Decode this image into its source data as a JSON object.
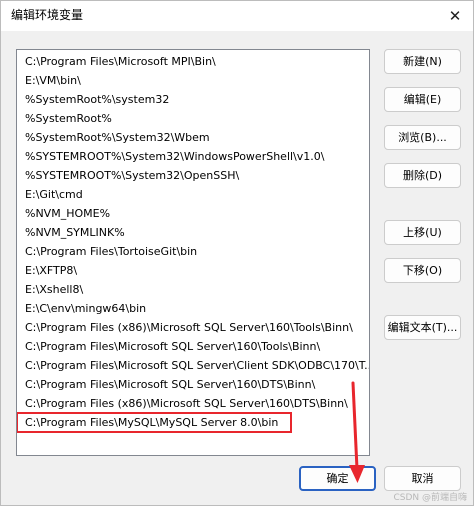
{
  "window": {
    "title": "编辑环境变量",
    "close_glyph": "✕"
  },
  "path_list": {
    "items": [
      {
        "text": "C:\\Program Files\\Microsoft MPI\\Bin\\"
      },
      {
        "text": "E:\\VM\\bin\\"
      },
      {
        "text": "%SystemRoot%\\system32"
      },
      {
        "text": "%SystemRoot%"
      },
      {
        "text": "%SystemRoot%\\System32\\Wbem"
      },
      {
        "text": "%SYSTEMROOT%\\System32\\WindowsPowerShell\\v1.0\\"
      },
      {
        "text": "%SYSTEMROOT%\\System32\\OpenSSH\\"
      },
      {
        "text": "E:\\Git\\cmd"
      },
      {
        "text": "%NVM_HOME%"
      },
      {
        "text": "%NVM_SYMLINK%"
      },
      {
        "text": "C:\\Program Files\\TortoiseGit\\bin"
      },
      {
        "text": "E:\\XFTP8\\"
      },
      {
        "text": "E:\\Xshell8\\"
      },
      {
        "text": "E:\\C\\env\\mingw64\\bin"
      },
      {
        "text": "C:\\Program Files (x86)\\Microsoft SQL Server\\160\\Tools\\Binn\\"
      },
      {
        "text": "C:\\Program Files\\Microsoft SQL Server\\160\\Tools\\Binn\\"
      },
      {
        "text": "C:\\Program Files\\Microsoft SQL Server\\Client SDK\\ODBC\\170\\T..."
      },
      {
        "text": "C:\\Program Files\\Microsoft SQL Server\\160\\DTS\\Binn\\"
      },
      {
        "text": "C:\\Program Files (x86)\\Microsoft SQL Server\\160\\DTS\\Binn\\"
      },
      {
        "text": "C:\\Program Files\\MySQL\\MySQL Server 8.0\\bin",
        "highlighted": true
      }
    ]
  },
  "side_buttons": {
    "new": "新建(N)",
    "edit": "编辑(E)",
    "browse": "浏览(B)...",
    "delete": "删除(D)",
    "move_up": "上移(U)",
    "move_down": "下移(O)",
    "edit_text": "编辑文本(T)..."
  },
  "footer": {
    "ok": "确定",
    "cancel": "取消"
  },
  "annotation": {
    "highlight_color": "#e8262d",
    "arrow_color": "#e8262d"
  },
  "watermark": "CSDN @前端自嗨"
}
